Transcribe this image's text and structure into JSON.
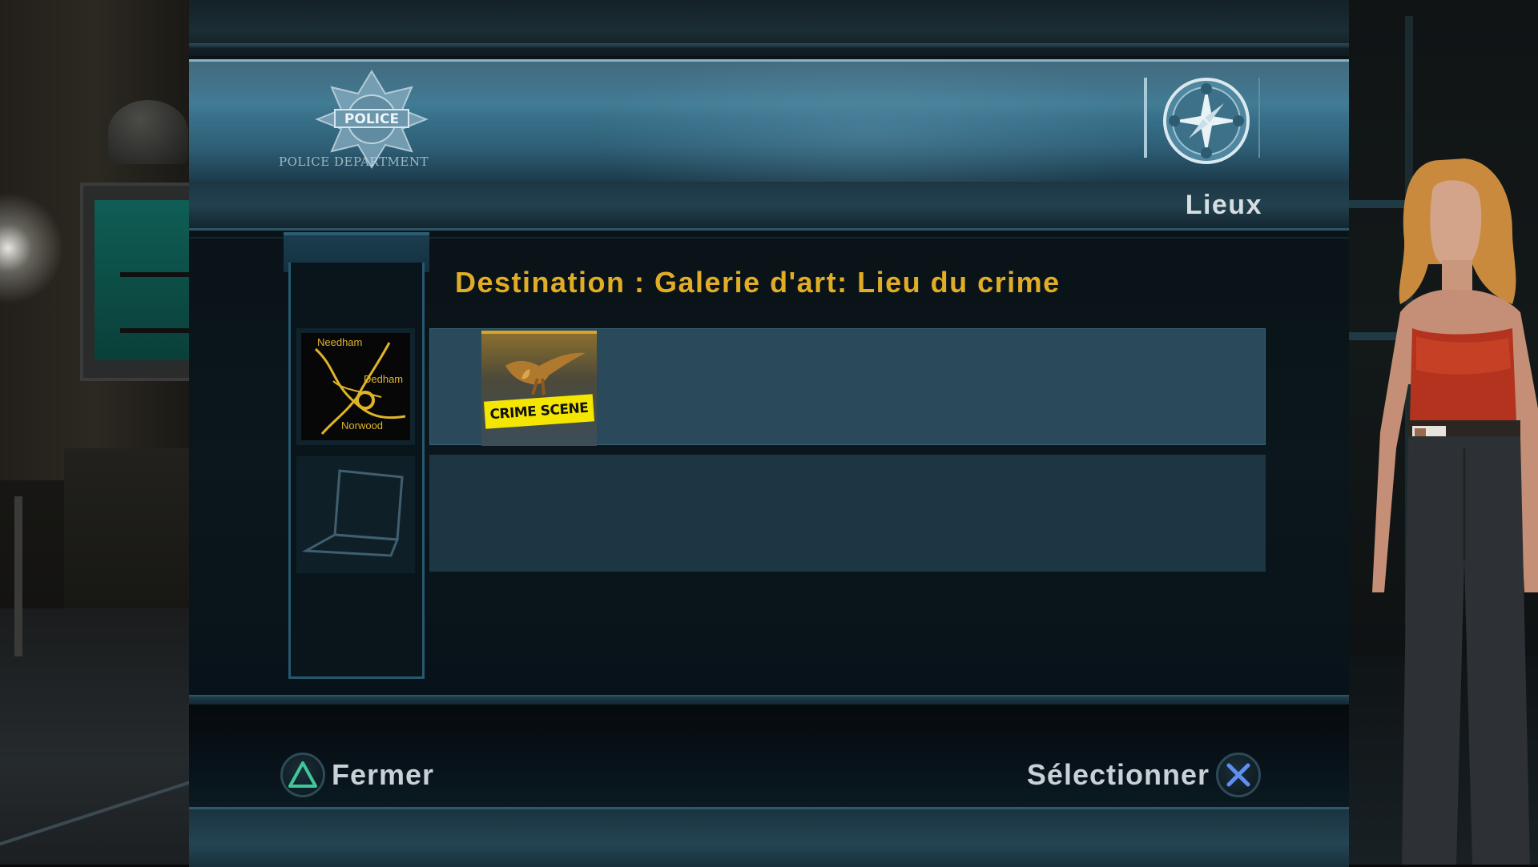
{
  "header": {
    "badge_caption": "POLICE DEPARTMENT",
    "badge_word": "POLICE",
    "section_label": "Lieux"
  },
  "main": {
    "title": "Destination : Galerie d'art: Lieu du crime",
    "rail_items": [
      {
        "icon": "city-map-icon",
        "labels": [
          "Needham",
          "Dedham",
          "Norwood"
        ]
      },
      {
        "icon": "laptop-icon"
      }
    ],
    "destinations": [
      {
        "thumbnail": "crime-scene-eagle-thumbnail",
        "tape_text": "CRIME SCENE",
        "selected": true
      },
      {
        "thumbnail": null,
        "selected": false
      }
    ]
  },
  "footer": {
    "close_label": "Fermer",
    "close_icon": "triangle-button-icon",
    "select_label": "Sélectionner",
    "select_icon": "cross-button-icon"
  },
  "colors": {
    "accent_title": "#e2ad26",
    "triangle": "#3fc79a",
    "cross": "#5f8ff0",
    "header_blue": "#3d7892"
  }
}
